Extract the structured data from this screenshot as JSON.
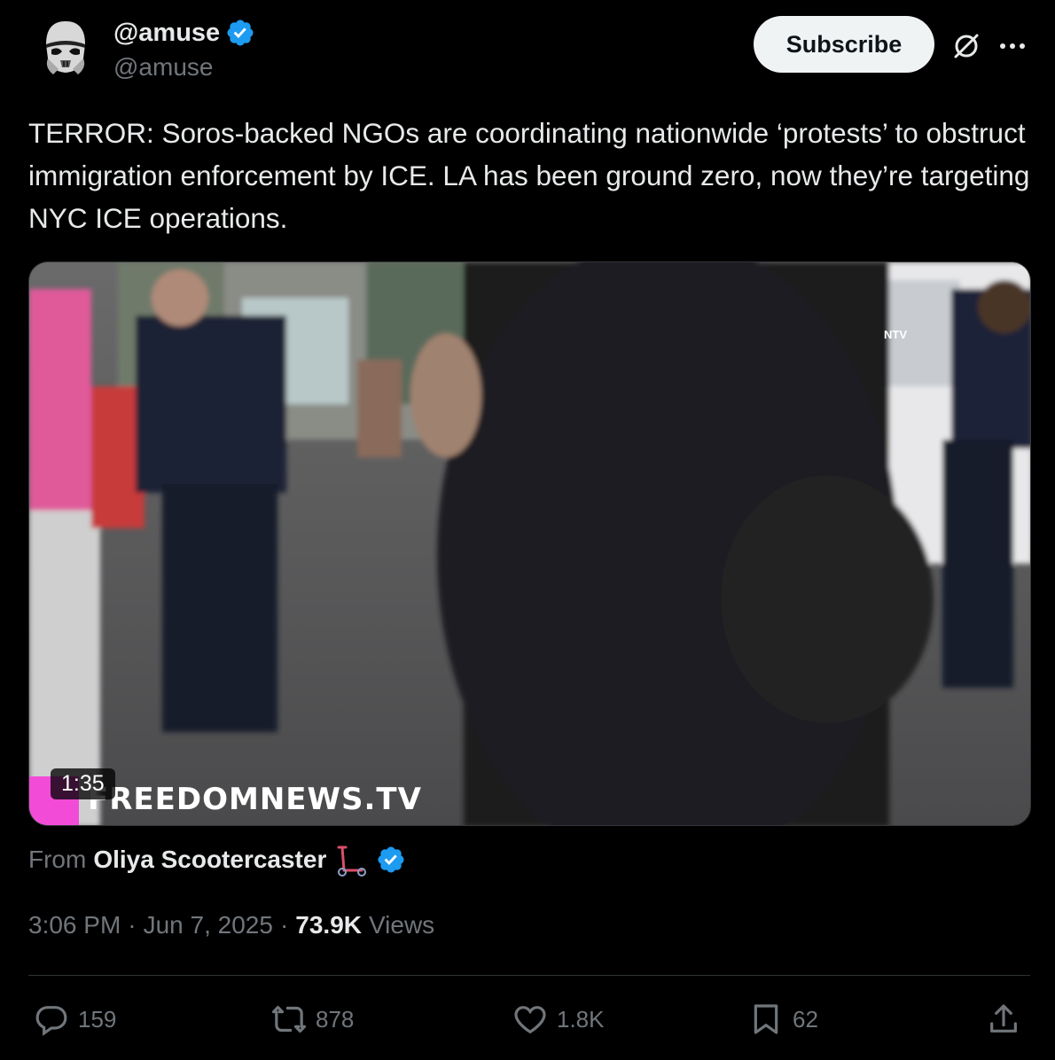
{
  "author": {
    "display_name": "@amuse",
    "handle": "@amuse",
    "verified": true,
    "avatar_icon": "stormtrooper-avatar"
  },
  "header": {
    "subscribe_label": "Subscribe",
    "grok_icon": "grok-icon",
    "more_icon": "more-icon"
  },
  "tweet": {
    "text": "TERROR: Soros-backed NGOs are coordinating nationwide ‘protests’ to obstruct immigration enforcement by ICE. LA has been ground zero, now they’re targeting NYC ICE operations."
  },
  "media": {
    "duration": "1:35",
    "watermark": "FREEDOMNEWS.TV",
    "corner_logo": "NTV"
  },
  "source": {
    "from_label": "From",
    "author": "Oliya Scootercaster",
    "emoji_icon": "scooter-icon",
    "verified": true
  },
  "meta": {
    "time": "3:06 PM",
    "separator": "·",
    "date": "Jun 7, 2025",
    "views_count": "73.9K",
    "views_label": "Views"
  },
  "actions": {
    "replies": "159",
    "reposts": "878",
    "likes": "1.8K",
    "bookmarks": "62"
  },
  "colors": {
    "background": "#000000",
    "text": "#e7e9ea",
    "secondary": "#71767b",
    "verified_blue": "#1d9bf0",
    "divider": "#2f3336"
  }
}
